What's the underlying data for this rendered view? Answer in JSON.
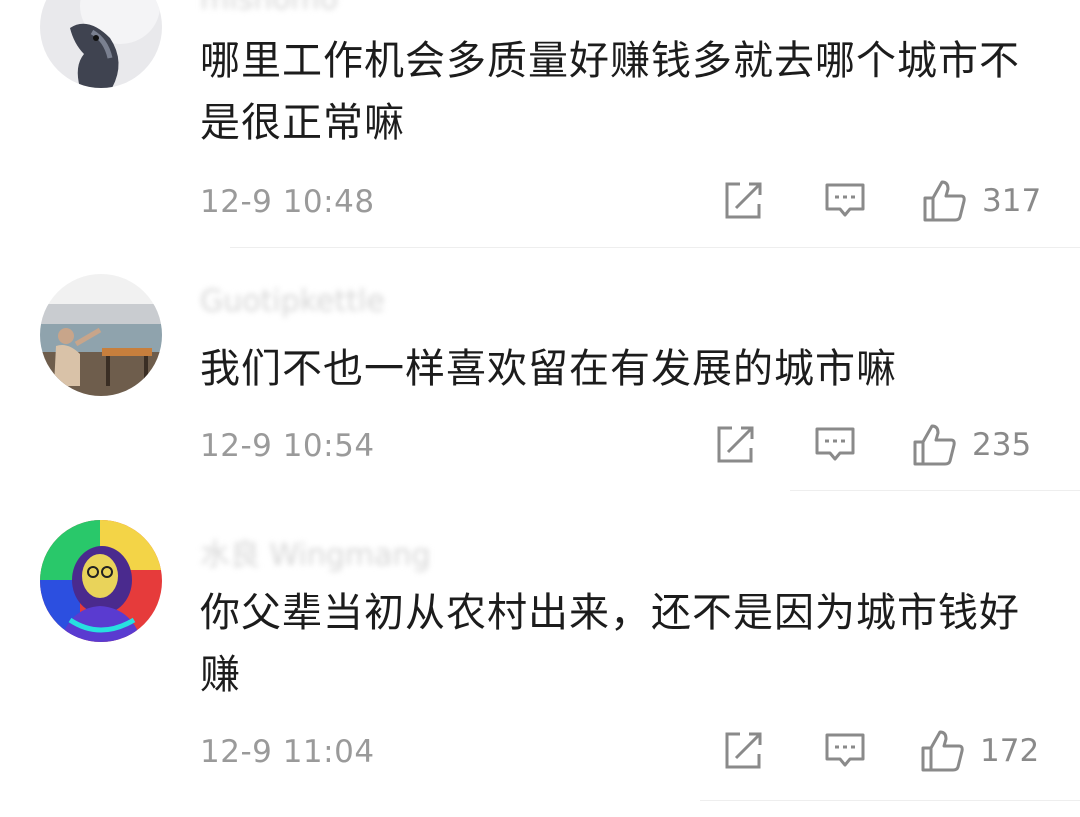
{
  "comments": [
    {
      "username": "mishomo",
      "text": "哪里工作机会多质量好赚钱多就去哪个城市不是很正常嘛",
      "time": "12-9 10:48",
      "likes": "317",
      "avatar_icon": "avatar-dog-icon"
    },
    {
      "username": "Guotipkettle",
      "text": "我们不也一样喜欢留在有发展的城市嘛",
      "time": "12-9 10:54",
      "likes": "235",
      "avatar_icon": "avatar-cafe-photo-icon"
    },
    {
      "username": "水良 Wingmang",
      "text": "你父辈当初从农村出来，还不是因为城市钱好赚",
      "time": "12-9 11:04",
      "likes": "172",
      "avatar_icon": "avatar-colorful-portrait-icon"
    }
  ],
  "icons": {
    "share": "share-edit-icon",
    "reply": "reply-comment-icon",
    "like": "thumbs-up-icon"
  },
  "colors": {
    "text": "#1c1c1c",
    "meta": "#9a9a9a",
    "icon": "#8a8a8a"
  }
}
